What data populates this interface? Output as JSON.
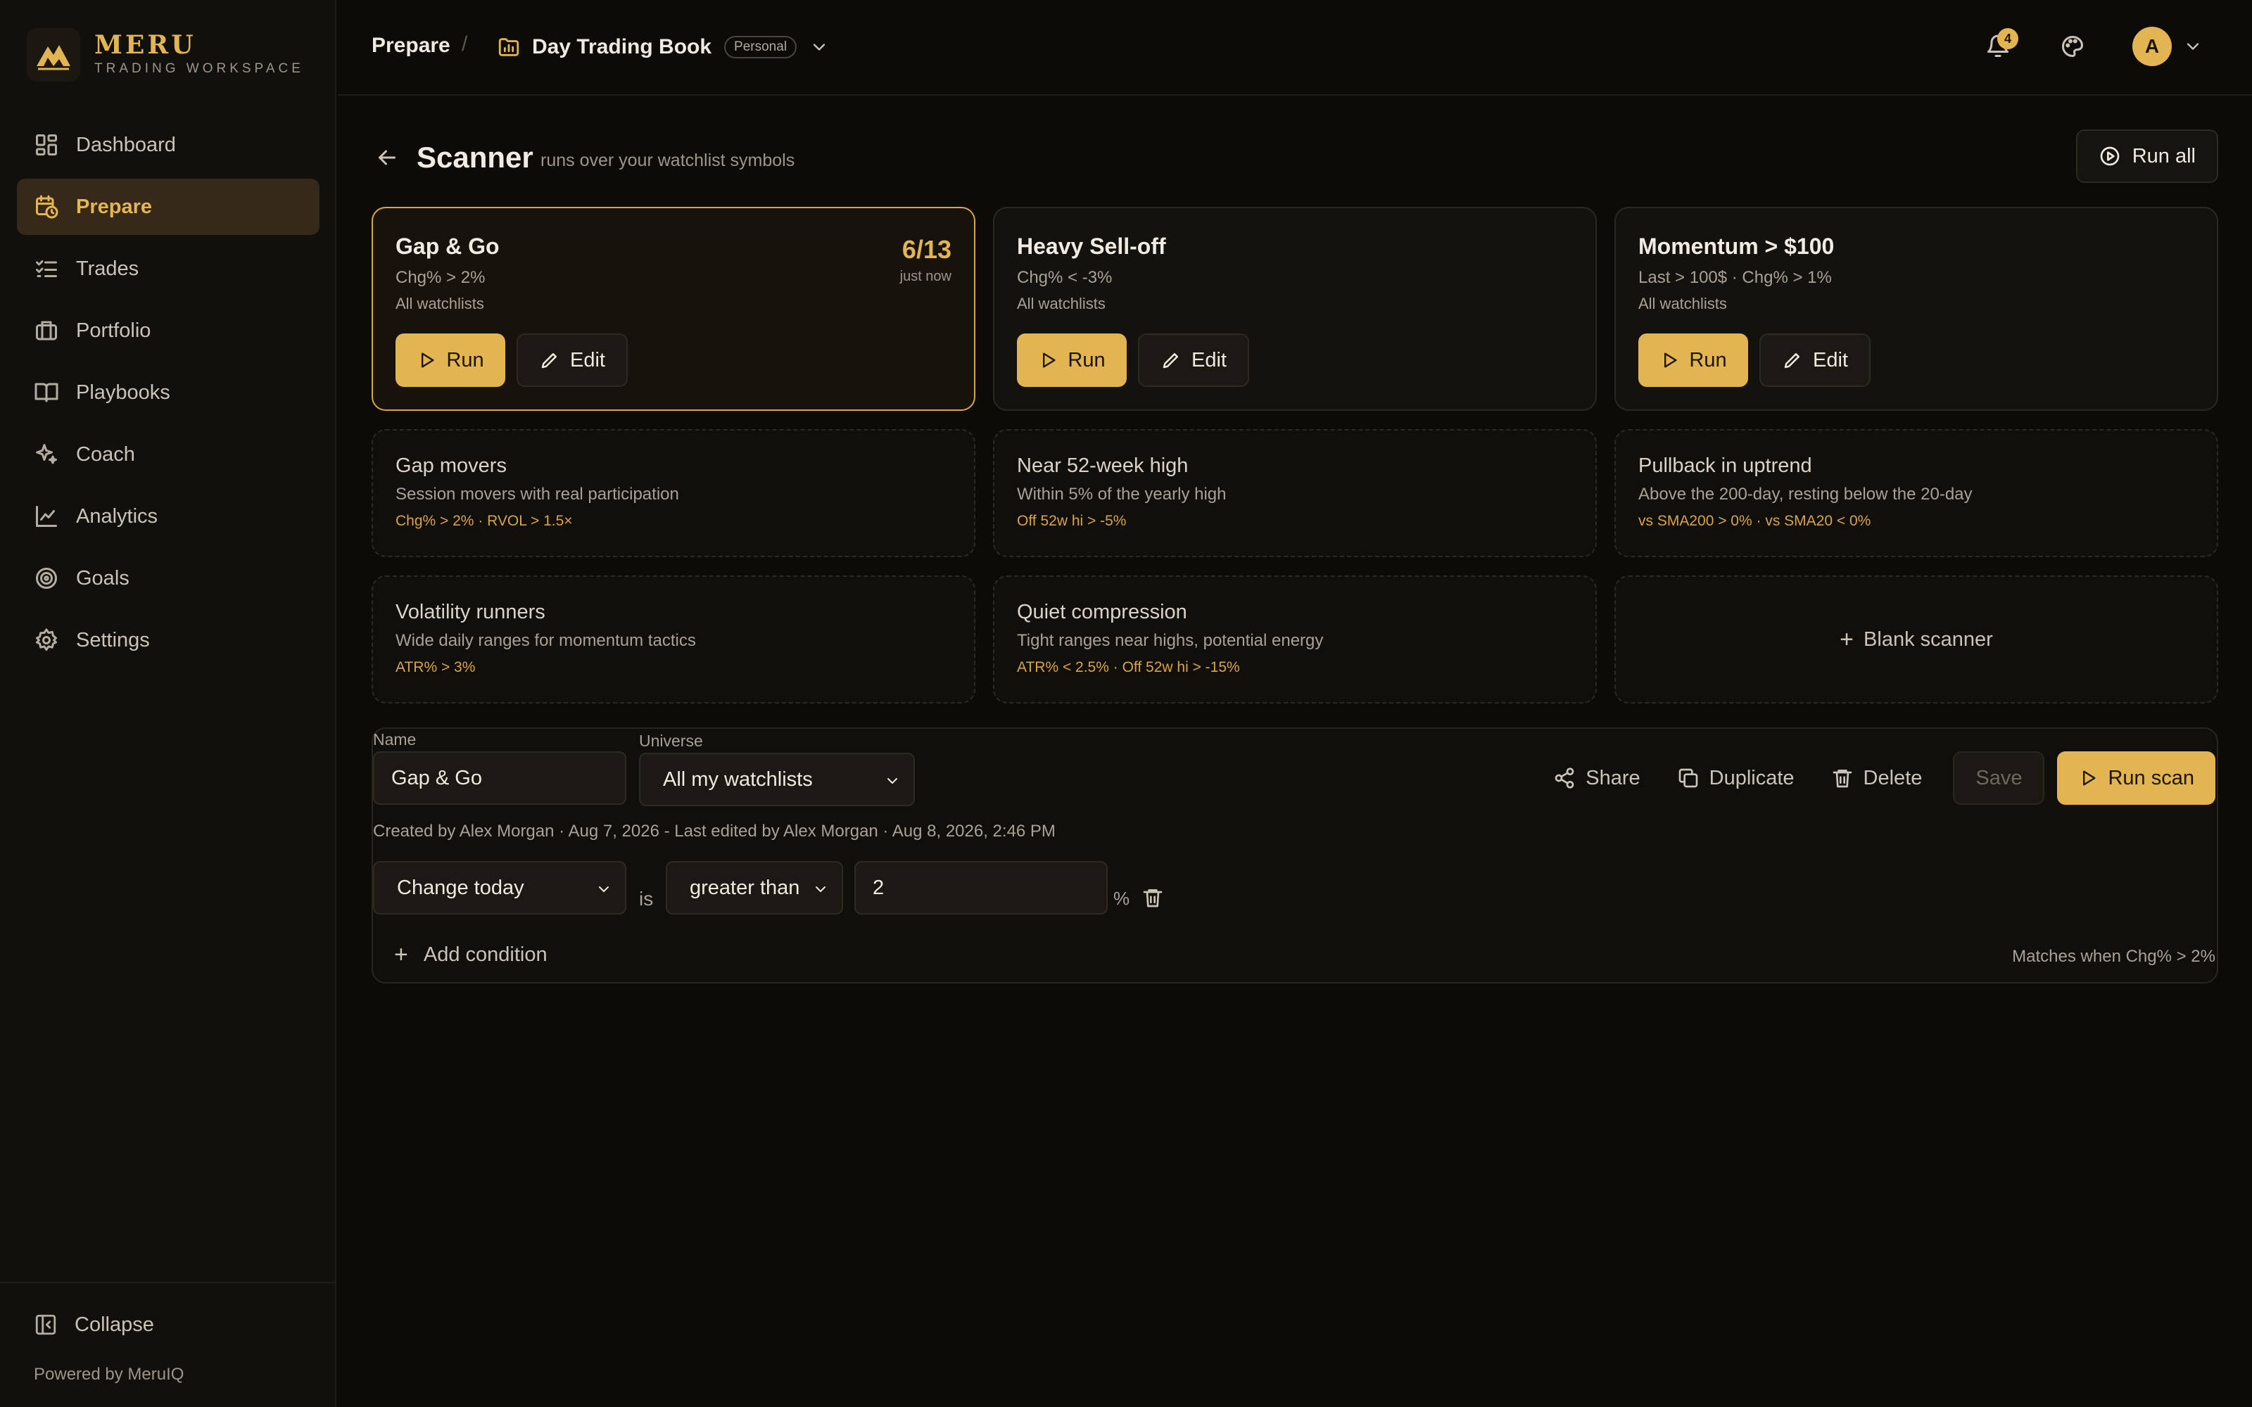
{
  "brand": {
    "name": "MERU",
    "subtitle": "TRADING WORKSPACE",
    "powered_by": "Powered by MeruIQ"
  },
  "colors": {
    "accent": "#e2b550",
    "background": "#0d0b08",
    "sidebar": "#12100c",
    "active_nav": "#35291a",
    "rule_text": "#d9a445"
  },
  "nav": {
    "items": [
      {
        "label": "Dashboard",
        "icon": "dashboard-icon"
      },
      {
        "label": "Prepare",
        "icon": "calendar-clock-icon",
        "active": true
      },
      {
        "label": "Trades",
        "icon": "list-checks-icon"
      },
      {
        "label": "Portfolio",
        "icon": "briefcase-icon"
      },
      {
        "label": "Playbooks",
        "icon": "book-icon"
      },
      {
        "label": "Coach",
        "icon": "sparkles-icon"
      },
      {
        "label": "Analytics",
        "icon": "line-chart-icon"
      },
      {
        "label": "Goals",
        "icon": "target-icon"
      },
      {
        "label": "Settings",
        "icon": "gear-icon"
      }
    ],
    "collapse_label": "Collapse"
  },
  "topbar": {
    "breadcrumb": "Prepare",
    "separator": "/",
    "book_title": "Day Trading Book",
    "book_badge": "Personal",
    "notification_count": "4",
    "avatar_initial": "A"
  },
  "page": {
    "title": "Scanner",
    "subtitle": "runs over your watchlist symbols",
    "run_all_label": "Run all"
  },
  "scanners": [
    {
      "title": "Gap & Go",
      "condition": "Chg% > 2%",
      "scope": "All watchlists",
      "stat": "6/13",
      "stat_time": "just now",
      "selected": true,
      "run_label": "Run",
      "edit_label": "Edit"
    },
    {
      "title": "Heavy Sell-off",
      "condition": "Chg% < -3%",
      "scope": "All watchlists",
      "run_label": "Run",
      "edit_label": "Edit"
    },
    {
      "title": "Momentum > $100",
      "condition": "Last > 100$ · Chg% > 1%",
      "scope": "All watchlists",
      "run_label": "Run",
      "edit_label": "Edit"
    }
  ],
  "templates": [
    {
      "title": "Gap movers",
      "description": "Session movers with real participation",
      "rule": "Chg% > 2% · RVOL > 1.5×"
    },
    {
      "title": "Near 52-week high",
      "description": "Within 5% of the yearly high",
      "rule": "Off 52w hi > -5%"
    },
    {
      "title": "Pullback in uptrend",
      "description": "Above the 200-day, resting below the 20-day",
      "rule": "vs SMA200 > 0% · vs SMA20 < 0%"
    },
    {
      "title": "Volatility runners",
      "description": "Wide daily ranges for momentum tactics",
      "rule": "ATR% > 3%"
    },
    {
      "title": "Quiet compression",
      "description": "Tight ranges near highs, potential energy",
      "rule": "ATR% < 2.5% · Off 52w hi > -15%"
    }
  ],
  "blank_scanner_label": "Blank scanner",
  "editor": {
    "name_label": "Name",
    "name_value": "Gap & Go",
    "universe_label": "Universe",
    "universe_value": "All my watchlists",
    "actions": {
      "share": "Share",
      "duplicate": "Duplicate",
      "delete": "Delete",
      "save": "Save",
      "run_scan": "Run scan"
    },
    "meta": "Created by Alex Morgan · Aug 7, 2026 - Last edited by Alex Morgan · Aug 8, 2026, 2:46 PM",
    "condition": {
      "field": "Change today",
      "is_text": "is",
      "operator": "greater than",
      "value": "2",
      "unit": "%"
    },
    "add_condition_label": "Add condition",
    "matches": "Matches when Chg% > 2%"
  }
}
